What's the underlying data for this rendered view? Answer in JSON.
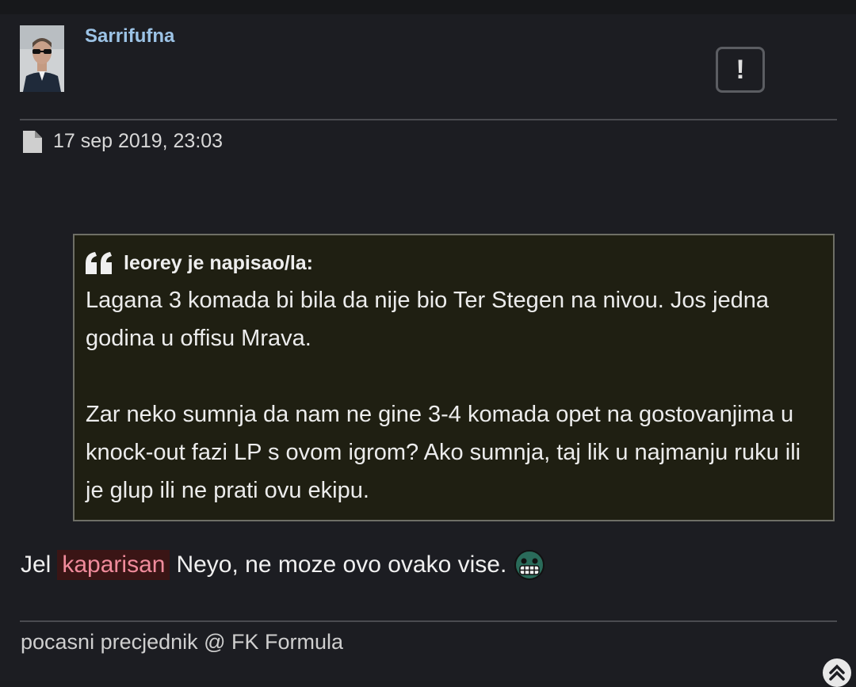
{
  "post": {
    "author": "Sarrifufna",
    "report_icon": "!",
    "timestamp": "17 sep 2019, 23:03",
    "quote": {
      "header": "leorey je napisao/la:",
      "paragraphs": [
        "Lagana 3 komada bi bila da nije bio Ter Stegen na nivou. Jos jedna godina u offisu Mrava.",
        "Zar neko sumnja da nam ne gine 3-4 komada opet na gostovanjima u knock-out fazi LP s ovom igrom? Ako sumnja, taj lik u najmanju ruku ili je glup ili ne prati ovu ekipu."
      ]
    },
    "message": {
      "before": "Jel",
      "mention": "kaparisan",
      "after": "Neyo, ne moze ovo ovako vise."
    },
    "signature": "pocasni precjednik @ FK Formula"
  },
  "icons": {
    "avatar": "avatar-photo",
    "report": "report-icon",
    "post_link": "document-icon",
    "quote": "quote-icon",
    "emoji": "grimace-emoji-icon",
    "scroll_top": "chevron-up-icon"
  },
  "colors": {
    "username": "#9cc3e6",
    "mention_text": "#f08b9c",
    "mention_bg": "#3a1515",
    "quote_bg": "#1f1f12",
    "background": "#1c1d22"
  }
}
